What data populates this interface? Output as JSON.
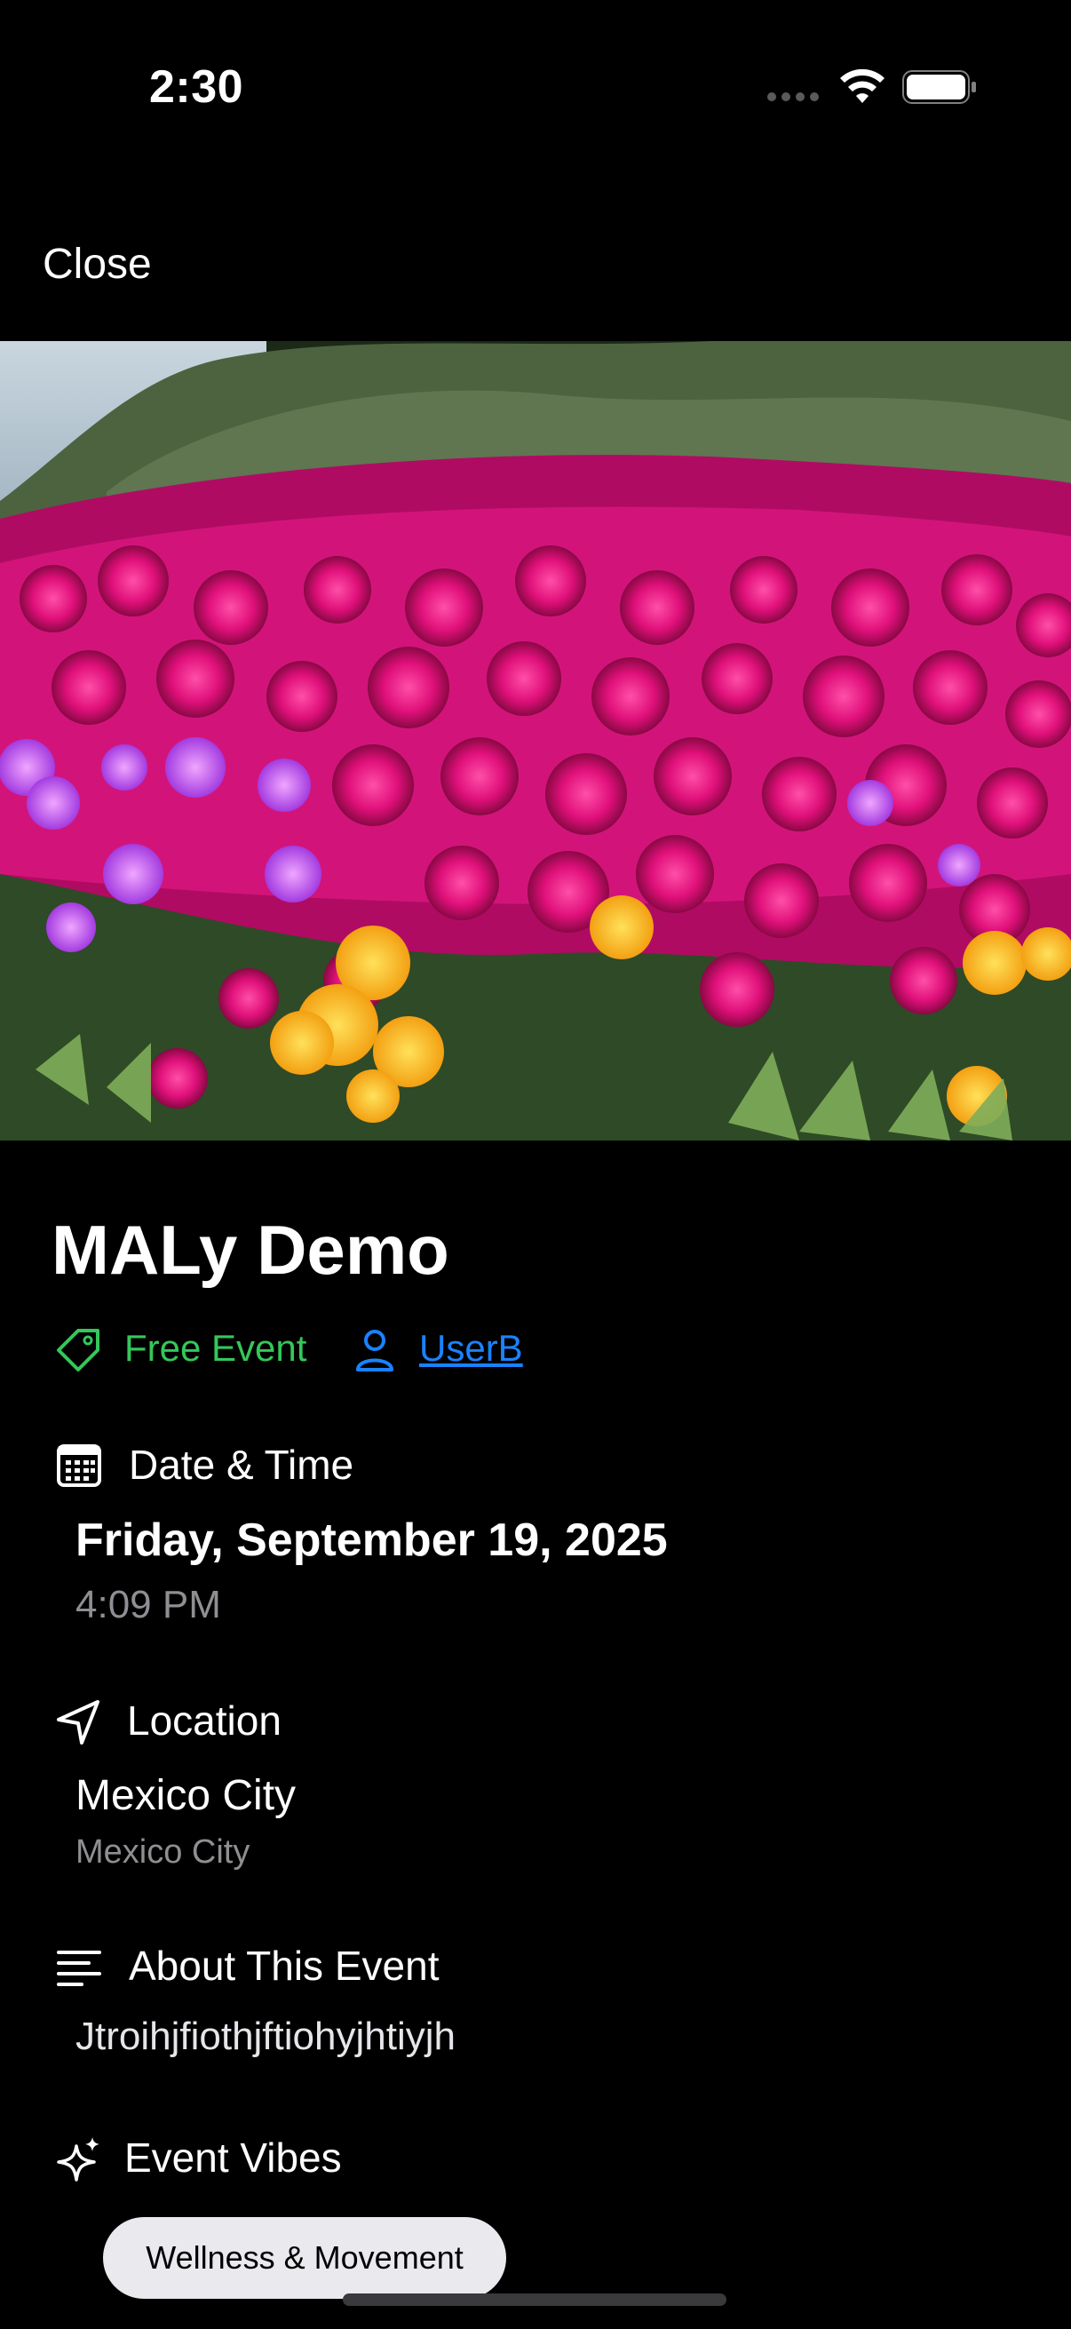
{
  "status_bar": {
    "time": "2:30"
  },
  "nav": {
    "close_label": "Close"
  },
  "event": {
    "title": "MALy Demo",
    "price_label": "Free Event",
    "host": "UserB",
    "date_section": {
      "label": "Date & Time",
      "date": "Friday, September 19, 2025",
      "time": "4:09 PM"
    },
    "location_section": {
      "label": "Location",
      "name": "Mexico City",
      "detail": "Mexico City"
    },
    "about_section": {
      "label": "About This Event",
      "text": "Jtroihjfiothjftiohyjhtiyjh"
    },
    "vibes_section": {
      "label": "Event Vibes",
      "tags": [
        "Wellness & Movement"
      ]
    }
  },
  "colors": {
    "free": "#34c759",
    "link": "#1a82ff",
    "muted": "#8e8e93"
  },
  "icons": {
    "tag": "tag-icon",
    "user": "person-icon",
    "calendar": "calendar-icon",
    "location": "location-arrow-icon",
    "about": "text-align-left-icon",
    "vibes": "sparkles-icon"
  }
}
